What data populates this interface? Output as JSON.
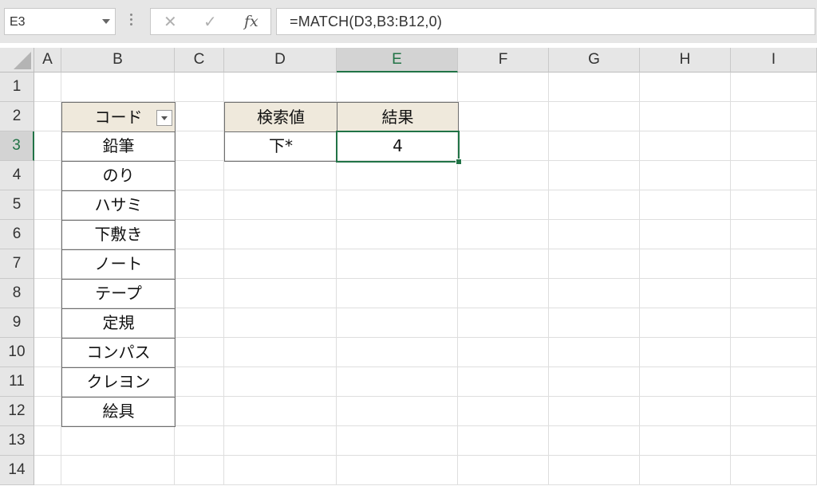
{
  "formula_bar": {
    "name_box": "E3",
    "cancel_glyph": "✕",
    "enter_glyph": "✓",
    "fx_glyph": "fx",
    "formula": "=MATCH(D3,B3:B12,0)"
  },
  "columns": [
    "A",
    "B",
    "C",
    "D",
    "E",
    "F",
    "G",
    "H",
    "I"
  ],
  "rows": [
    "1",
    "2",
    "3",
    "4",
    "5",
    "6",
    "7",
    "8",
    "9",
    "10",
    "11",
    "12",
    "13",
    "14"
  ],
  "selected": {
    "column": "E",
    "row": "3"
  },
  "code_table": {
    "header": "コード",
    "items": [
      "鉛筆",
      "のり",
      "ハサミ",
      "下敷き",
      "ノート",
      "テープ",
      "定規",
      "コンパス",
      "クレヨン",
      "絵具"
    ]
  },
  "lookup_table": {
    "search_header": "検索値",
    "result_header": "結果",
    "search_value": "下*",
    "result_value": "4"
  },
  "colors": {
    "accent": "#217346",
    "header_fill": "#efe9dc"
  }
}
